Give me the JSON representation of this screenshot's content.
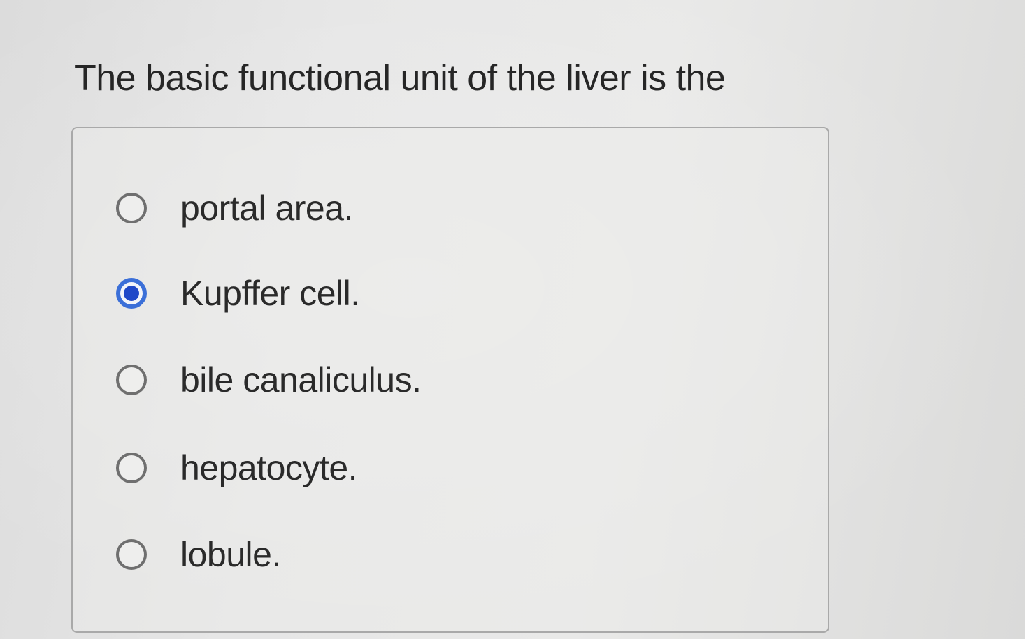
{
  "question": {
    "text": "The basic functional unit of the liver is the"
  },
  "options": [
    {
      "label": "portal area.",
      "selected": false
    },
    {
      "label": "Kupffer cell.",
      "selected": true
    },
    {
      "label": "bile canaliculus.",
      "selected": false
    },
    {
      "label": "hepatocyte.",
      "selected": false
    },
    {
      "label": "lobule.",
      "selected": false
    }
  ],
  "colors": {
    "selected_radio": "#1f48c8",
    "radio_ring": "#6f6f6f",
    "box_border": "#a9a9a9"
  }
}
